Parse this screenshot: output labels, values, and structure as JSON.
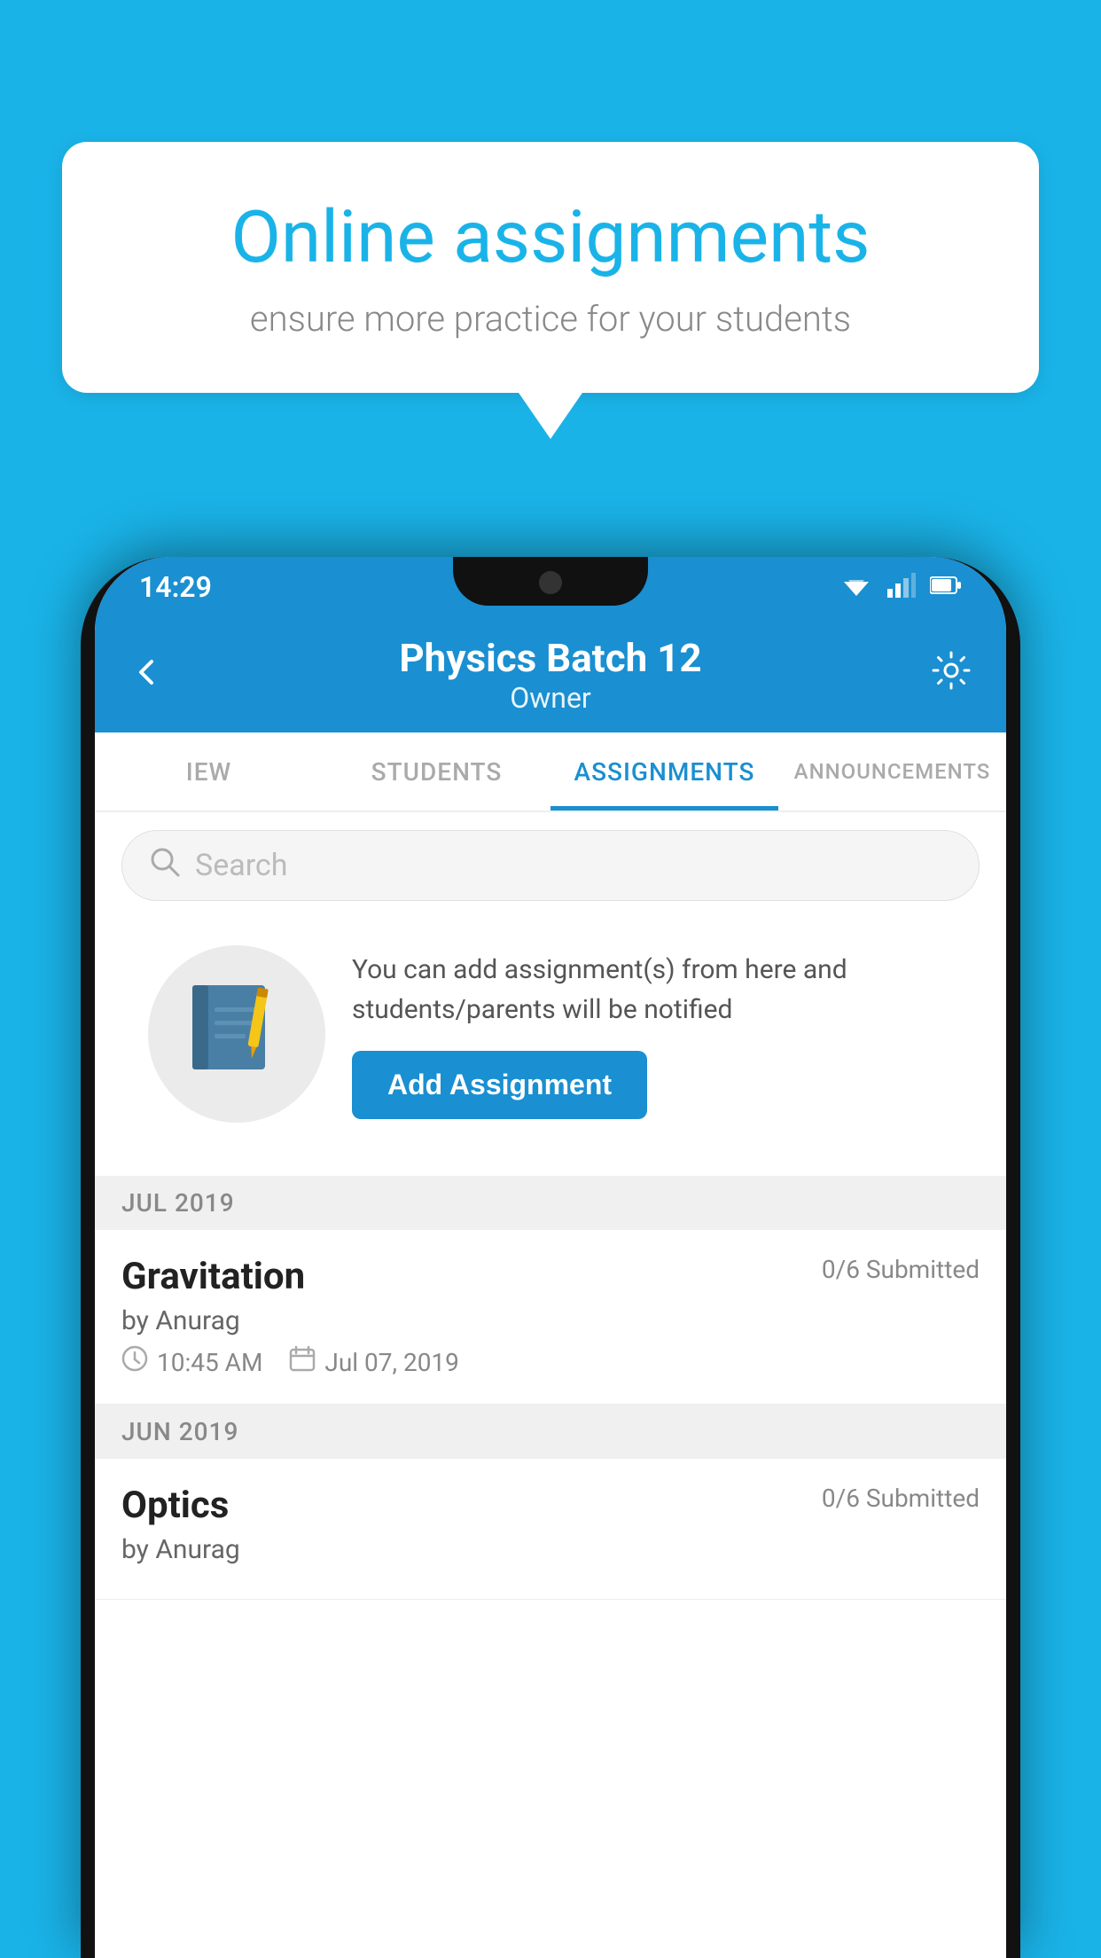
{
  "background_color": "#1ab3e8",
  "speech_bubble": {
    "title": "Online assignments",
    "subtitle": "ensure more practice for your students"
  },
  "phone": {
    "status_bar": {
      "time": "14:29",
      "wifi": "▼▲",
      "signal": "▲",
      "battery": "▓"
    },
    "header": {
      "back_label": "←",
      "title": "Physics Batch 12",
      "subtitle": "Owner",
      "settings_label": "⚙"
    },
    "tabs": [
      {
        "label": "IEW",
        "active": false
      },
      {
        "label": "STUDENTS",
        "active": false
      },
      {
        "label": "ASSIGNMENTS",
        "active": true
      },
      {
        "label": "ANNOUNCEMENTS",
        "active": false
      }
    ],
    "search": {
      "placeholder": "Search"
    },
    "info_card": {
      "description": "You can add assignment(s) from here and students/parents will be notified",
      "button_label": "Add Assignment"
    },
    "sections": [
      {
        "month_label": "JUL 2019",
        "assignments": [
          {
            "name": "Gravitation",
            "submitted": "0/6 Submitted",
            "by": "by Anurag",
            "time": "10:45 AM",
            "date": "Jul 07, 2019"
          }
        ]
      },
      {
        "month_label": "JUN 2019",
        "assignments": [
          {
            "name": "Optics",
            "submitted": "0/6 Submitted",
            "by": "by Anurag",
            "time": "",
            "date": ""
          }
        ]
      }
    ]
  }
}
